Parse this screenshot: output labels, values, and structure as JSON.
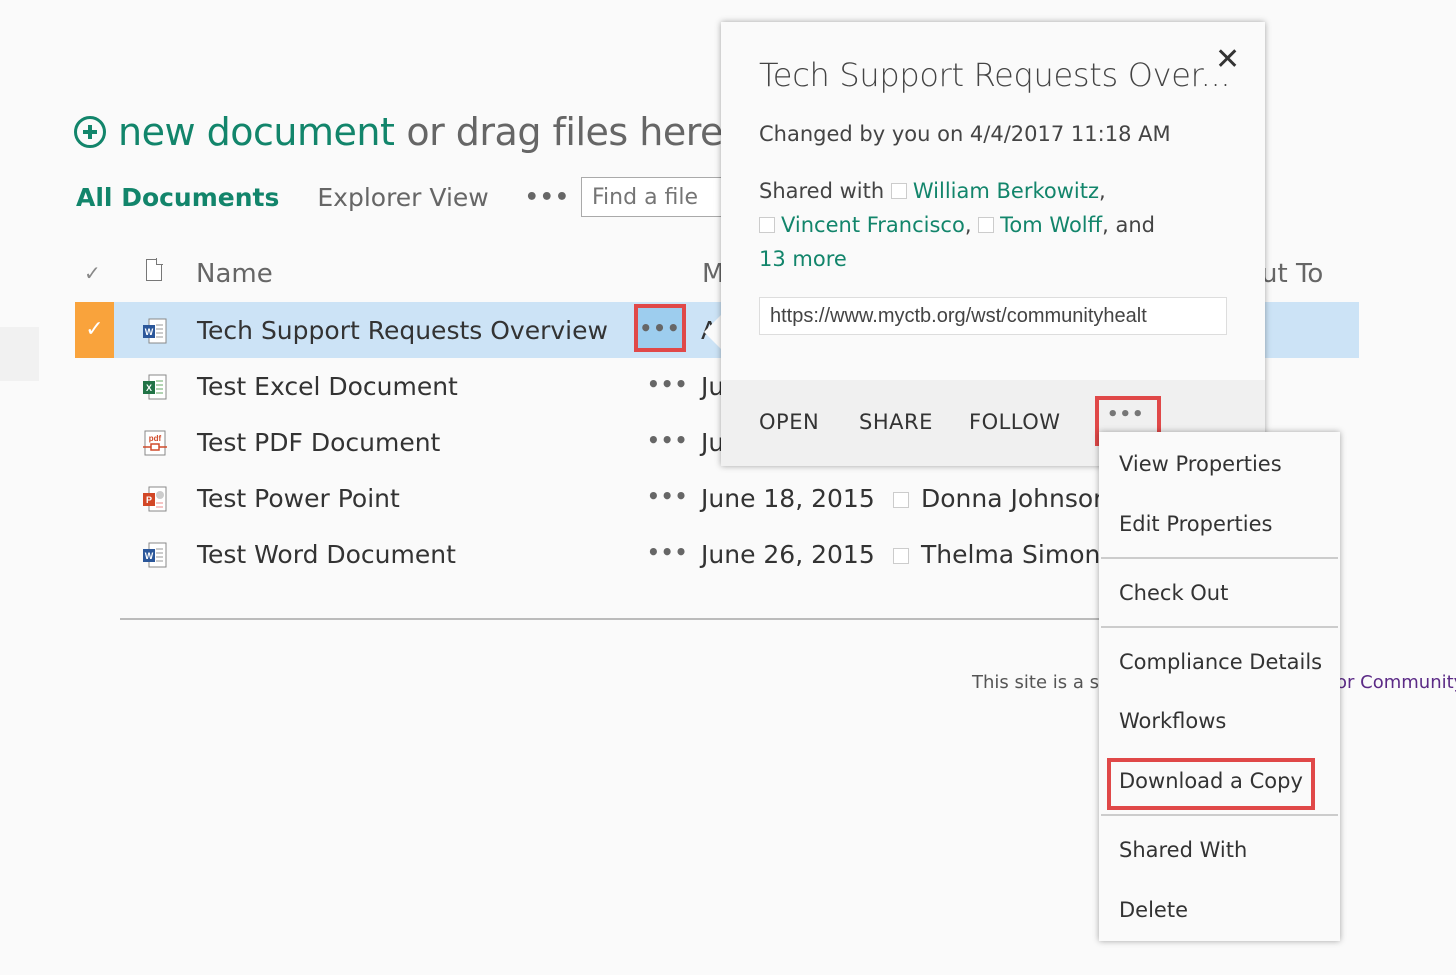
{
  "header": {
    "new_document": "new document",
    "drag_text": "or drag files here",
    "plus_icon": "circle-plus-icon"
  },
  "views": {
    "all_documents": "All Documents",
    "explorer_view": "Explorer View",
    "more": "•••",
    "search_placeholder": "Find a file"
  },
  "table": {
    "columns": {
      "check": "✓",
      "type_icon": "document-icon",
      "name": "Name",
      "modified": "M",
      "checked_out_to": "ut To"
    },
    "rows": [
      {
        "name": "Tech Support Requests Overview",
        "type": "word",
        "modified": "A",
        "person": "",
        "selected": true
      },
      {
        "name": "Test Excel Document",
        "type": "excel",
        "modified": "Ju",
        "person": "",
        "selected": false
      },
      {
        "name": "Test PDF Document",
        "type": "pdf",
        "modified": "Ju",
        "person": "",
        "selected": false
      },
      {
        "name": "Test Power Point",
        "type": "powerpoint",
        "modified": "June 18, 2015",
        "person": "Donna Johnsor",
        "selected": false
      },
      {
        "name": "Test Word Document",
        "type": "word",
        "modified": "June 26, 2015",
        "person": "Thelma Simons",
        "selected": false
      }
    ],
    "ellipsis": "•••",
    "selected_check": "✓"
  },
  "footer": {
    "text_left": "This site is a ser",
    "text_right": "or Community"
  },
  "callout": {
    "title": "Tech Support Requests Over...",
    "close": "✕",
    "changed": "Changed by you on 4/4/2017 11:18 AM",
    "shared_with_label": "Shared with",
    "shared_people": [
      "William Berkowitz",
      "Vincent Francisco",
      "Tom Wolff"
    ],
    "and_text": ", and",
    "more_link": "13 more",
    "url": "https://www.myctb.org/wst/communityhealt",
    "actions": {
      "open": "OPEN",
      "share": "SHARE",
      "follow": "FOLLOW",
      "more": "•••"
    }
  },
  "menu": {
    "items": [
      "View Properties",
      "Edit Properties",
      "Check Out",
      "Compliance Details",
      "Workflows",
      "Download a Copy",
      "Shared With",
      "Delete"
    ],
    "highlighted": "Download a Copy"
  },
  "colors": {
    "accent_green": "#12856b",
    "selected_row": "#cce3f6",
    "selected_check": "#f9a33c",
    "highlight_red": "#e04848",
    "footer_link": "#5b2a86"
  }
}
